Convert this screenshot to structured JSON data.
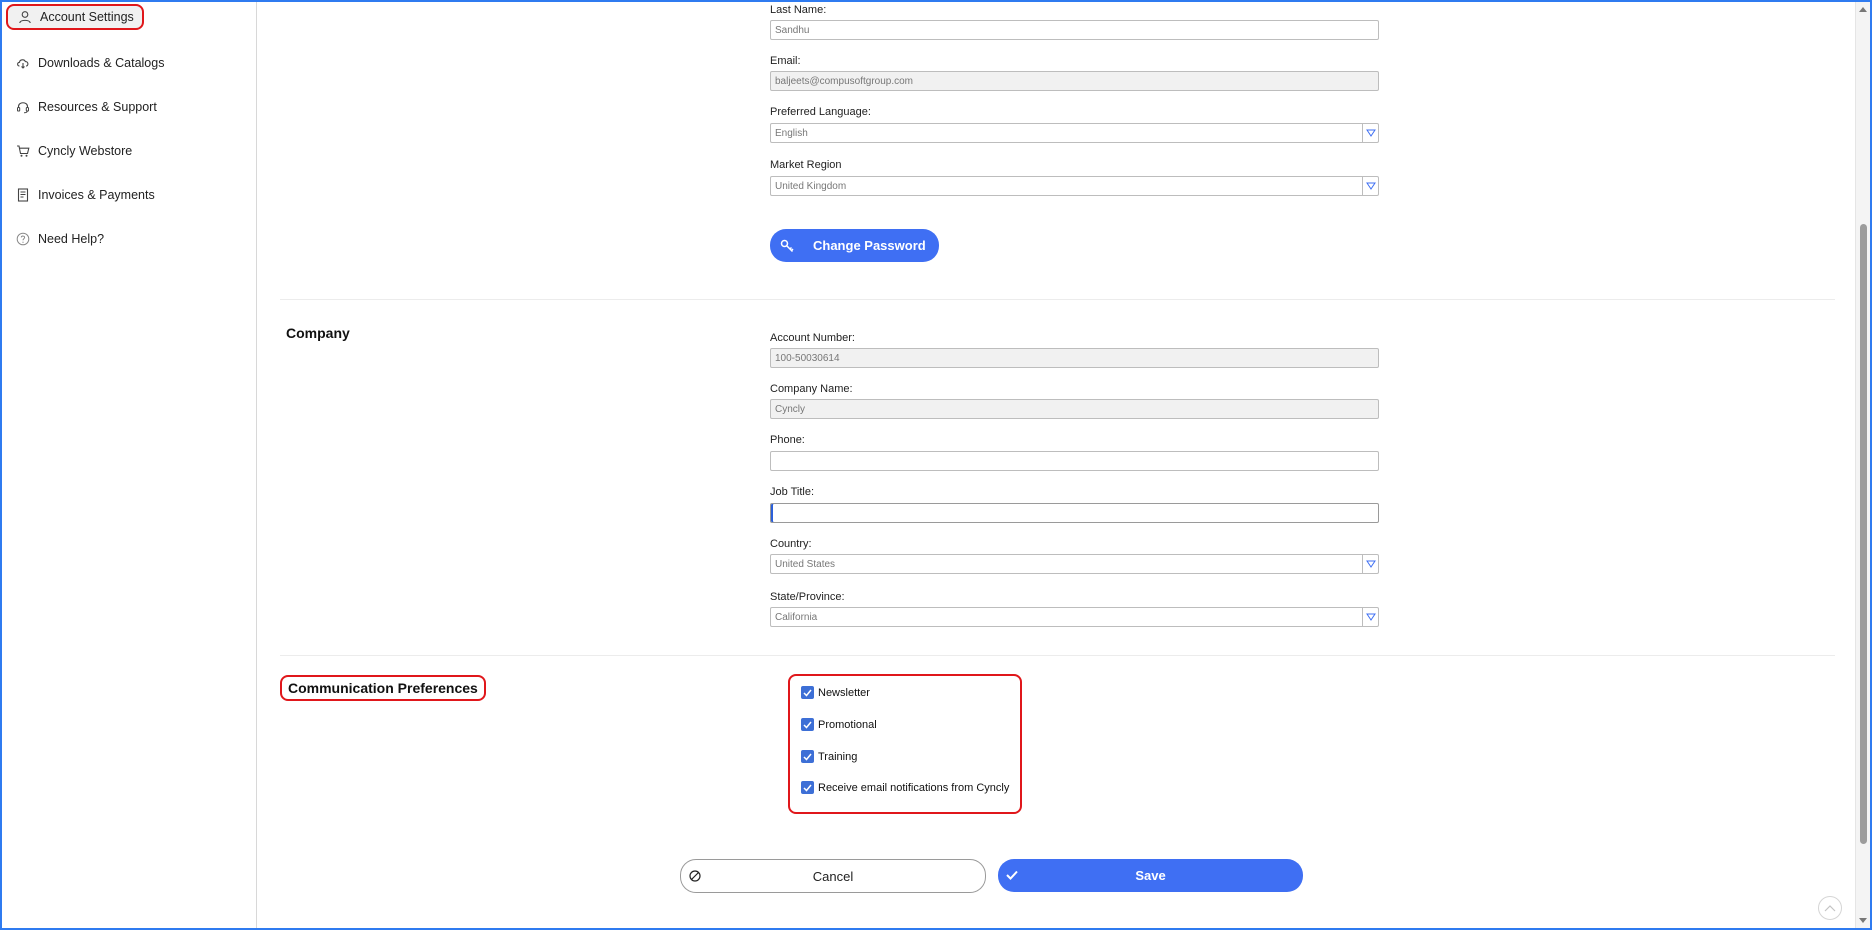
{
  "sidebar": {
    "items": [
      {
        "label": "Account Settings",
        "icon": "user-icon"
      },
      {
        "label": "Downloads & Catalogs",
        "icon": "cloud-download-icon"
      },
      {
        "label": "Resources & Support",
        "icon": "headset-icon"
      },
      {
        "label": "Cyncly Webstore",
        "icon": "cart-icon"
      },
      {
        "label": "Invoices & Payments",
        "icon": "invoice-icon"
      },
      {
        "label": "Need Help?",
        "icon": "help-icon"
      }
    ]
  },
  "profile": {
    "last_name": {
      "label": "Last Name:",
      "value": "Sandhu"
    },
    "email": {
      "label": "Email:",
      "value": "baljeets@compusoftgroup.com"
    },
    "language": {
      "label": "Preferred Language:",
      "value": "English"
    },
    "region": {
      "label": "Market Region",
      "value": "United Kingdom"
    },
    "change_password": "Change Password"
  },
  "company": {
    "title": "Company",
    "account_number": {
      "label": "Account Number:",
      "value": "100-50030614"
    },
    "company_name": {
      "label": "Company Name:",
      "value": "Cyncly"
    },
    "phone": {
      "label": "Phone:",
      "value": ""
    },
    "job_title": {
      "label": "Job Title:",
      "value": ""
    },
    "country": {
      "label": "Country:",
      "value": "United States"
    },
    "state": {
      "label": "State/Province:",
      "value": "California"
    }
  },
  "communication": {
    "title": "Communication Preferences",
    "options": [
      {
        "label": "Newsletter",
        "checked": true
      },
      {
        "label": "Promotional",
        "checked": true
      },
      {
        "label": "Training",
        "checked": true
      },
      {
        "label": "Receive email notifications from Cyncly",
        "checked": true
      }
    ]
  },
  "actions": {
    "cancel": "Cancel",
    "save": "Save"
  },
  "colors": {
    "accent": "#3f6ff3",
    "highlight": "#e0171b",
    "frame": "#2f7bf0"
  }
}
